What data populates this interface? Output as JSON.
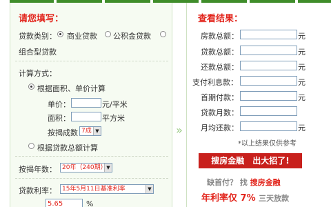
{
  "colors": {
    "accent": "#e2251c",
    "panel_bg": "#f6fbf2",
    "bar": "#3f8d2a"
  },
  "left": {
    "title": "请您填写：",
    "loan_type_label": "贷款类别：",
    "loan_types": [
      "商业贷款",
      "公积金贷款",
      "组合型贷款"
    ],
    "calc_method_label": "计算方式：",
    "method_area": "根据面积、单价计算",
    "unit_price_label": "单价：",
    "unit_price_unit": "元/平米",
    "area_label": "面积：",
    "area_unit": "平方米",
    "ratio_label": "按揭成数：",
    "ratio_value": "7成",
    "method_total": "根据贷款总额计算",
    "years_label": "按揭年数：",
    "years_value": "20年（240期）",
    "rate_label": "贷款利率：",
    "rate_value": "15年5月11日基准利率",
    "rate_input": "5.65",
    "rate_unit": "%"
  },
  "right": {
    "title": "查看结果：",
    "rows": [
      {
        "label": "房款总额：",
        "unit": "元"
      },
      {
        "label": "贷款总额：",
        "unit": "元"
      },
      {
        "label": "还款总额：",
        "unit": "元"
      },
      {
        "label": "支付利息款：",
        "unit": "元"
      },
      {
        "label": "首期付款：",
        "unit": "元"
      },
      {
        "label": "贷款月数：",
        "unit": ""
      },
      {
        "label": "月均还款：",
        "unit": "元"
      }
    ],
    "note": "*以上结果仅供参考"
  },
  "ad": {
    "banner": "搜房金融　出大招了!",
    "line1_a": "缺首付？",
    "line1_b": "找",
    "line1_c": "搜房金融",
    "line2_a": "年利率仅",
    "line2_b": "7%",
    "line2_c": "三天放款"
  },
  "arrow_glyph": "»"
}
